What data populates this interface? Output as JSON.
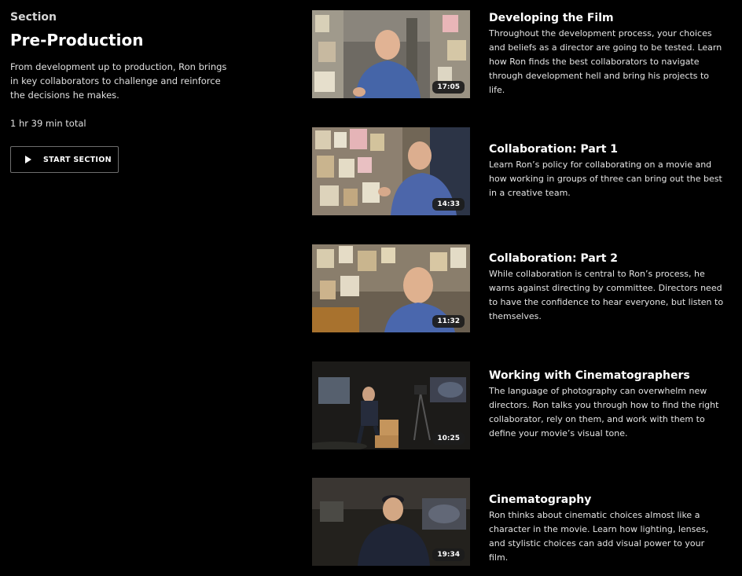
{
  "section": {
    "eyebrow": "Section",
    "title": "Pre-Production",
    "description": "From development up to production, Ron brings in key collaborators to challenge and reinforce the decisions he makes.",
    "total": "1 hr 39 min total",
    "start_label": "START SECTION"
  },
  "lessons": [
    {
      "title": "Developing the Film",
      "duration": "17:05",
      "description": "Throughout the development process, your choices and beliefs as a director are going to be tested. Learn how Ron finds the best collaborators to navigate through development hell and bring his projects to life."
    },
    {
      "title": "Collaboration: Part 1",
      "duration": "14:33",
      "description": "Learn Ron’s policy for collaborating on a movie and how working in groups of three can bring out the best in a creative team."
    },
    {
      "title": "Collaboration: Part 2",
      "duration": "11:32",
      "description": "While collaboration is central to Ron’s process, he warns against directing by committee. Directors need to have the confidence to hear everyone, but listen to themselves."
    },
    {
      "title": "Working with Cinematographers",
      "duration": "10:25",
      "description": "The language of photography can overwhelm new directors. Ron talks you through how to find the right collaborator, rely on them, and work with them to define your movie’s visual tone."
    },
    {
      "title": "Cinematography",
      "duration": "19:34",
      "description": "Ron thinks about cinematic choices almost like a character in the movie. Learn how lighting, lenses, and stylistic choices can add visual power to your film."
    }
  ]
}
